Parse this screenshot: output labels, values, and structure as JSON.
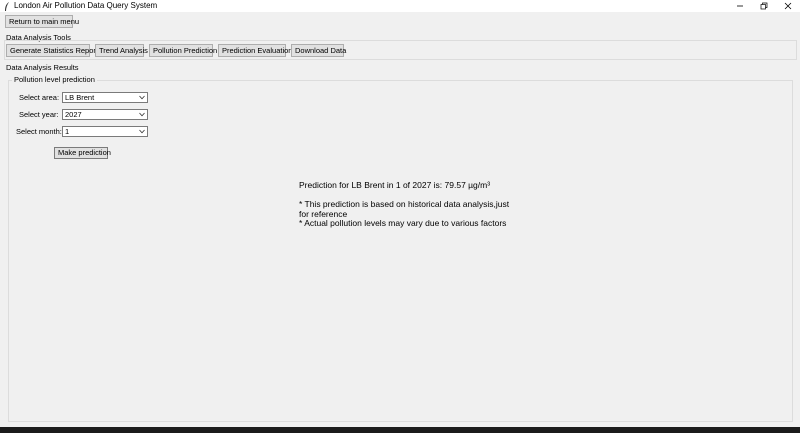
{
  "window": {
    "title": "London Air Pollution Data Query System",
    "icon": "feather-icon"
  },
  "nav": {
    "return_label": "Return to main menu"
  },
  "tools": {
    "section_label": "Data Analysis Tools",
    "buttons": [
      {
        "label": "Generate Statistics Report"
      },
      {
        "label": "Trend Analysis"
      },
      {
        "label": "Pollution Prediction"
      },
      {
        "label": "Prediction Evaluation"
      },
      {
        "label": "Download Data"
      }
    ]
  },
  "results": {
    "section_label": "Data Analysis Results",
    "group_title": "Pollution level prediction",
    "area_label": "Select area:",
    "area_value": "LB Brent",
    "year_label": "Select year:",
    "year_value": "2027",
    "month_label": "Select month:",
    "month_value": "1",
    "predict_button": "Make prediction",
    "output": {
      "line1": "Prediction for LB Brent in 1 of 2027 is: 79.57 µg/m³",
      "line2": "* This prediction is based on historical data analysis,just",
      "line3": "for reference",
      "line4": "* Actual pollution levels may vary due to various factors"
    }
  },
  "colors": {
    "background": "#f0f0f0",
    "button_face": "#e1e1e1",
    "button_border": "#adadad",
    "taskbar": "#1b1b1b"
  }
}
